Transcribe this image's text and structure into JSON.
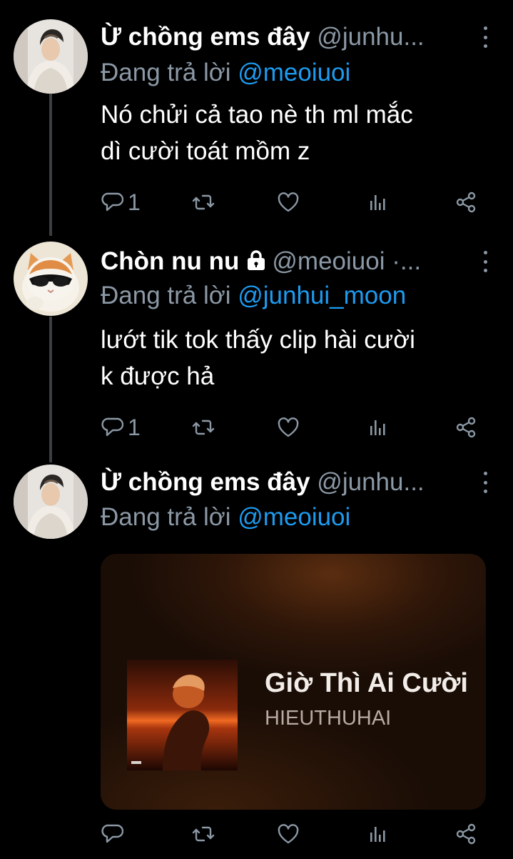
{
  "colors": {
    "background": "#000000",
    "muted": "#8b98a5",
    "mention": "#1d9bf0",
    "thread_line": "#3a3f44"
  },
  "tweets": [
    {
      "display_name": "Ừ chồng ems đây",
      "handle": "@junhu...",
      "reply_prefix": "Đang trả lời",
      "reply_to": "@meoiuoi",
      "text_lines": [
        "Nó chửi cả tao nè th ml mắc",
        "dì cười toát mồm z"
      ],
      "reply_count": "1",
      "avatar": "boy-in-hoodie-avatar"
    },
    {
      "display_name": "Chòn nu nu",
      "locked_icon": "lock-icon",
      "handle": "@meoiuoi ·...",
      "reply_prefix": "Đang trả lời",
      "reply_to": "@junhui_moon",
      "text_lines": [
        "lướt tik tok thấy clip hài cười",
        "k được hả"
      ],
      "reply_count": "1",
      "avatar": "cat-with-sunglasses-avatar"
    },
    {
      "display_name": "Ừ chồng ems đây",
      "handle": "@junhu...",
      "reply_prefix": "Đang trả lời",
      "reply_to": "@meoiuoi",
      "avatar": "boy-in-hoodie-avatar",
      "music_card": {
        "title": "Giờ Thì Ai Cười",
        "artist": "HIEUTHUHAI"
      }
    }
  ],
  "icons": {
    "reply": "reply-bubble-icon",
    "retweet": "retweet-icon",
    "like": "heart-icon",
    "views": "analytics-icon",
    "share": "share-icon",
    "more": "more-vertical-icon"
  }
}
